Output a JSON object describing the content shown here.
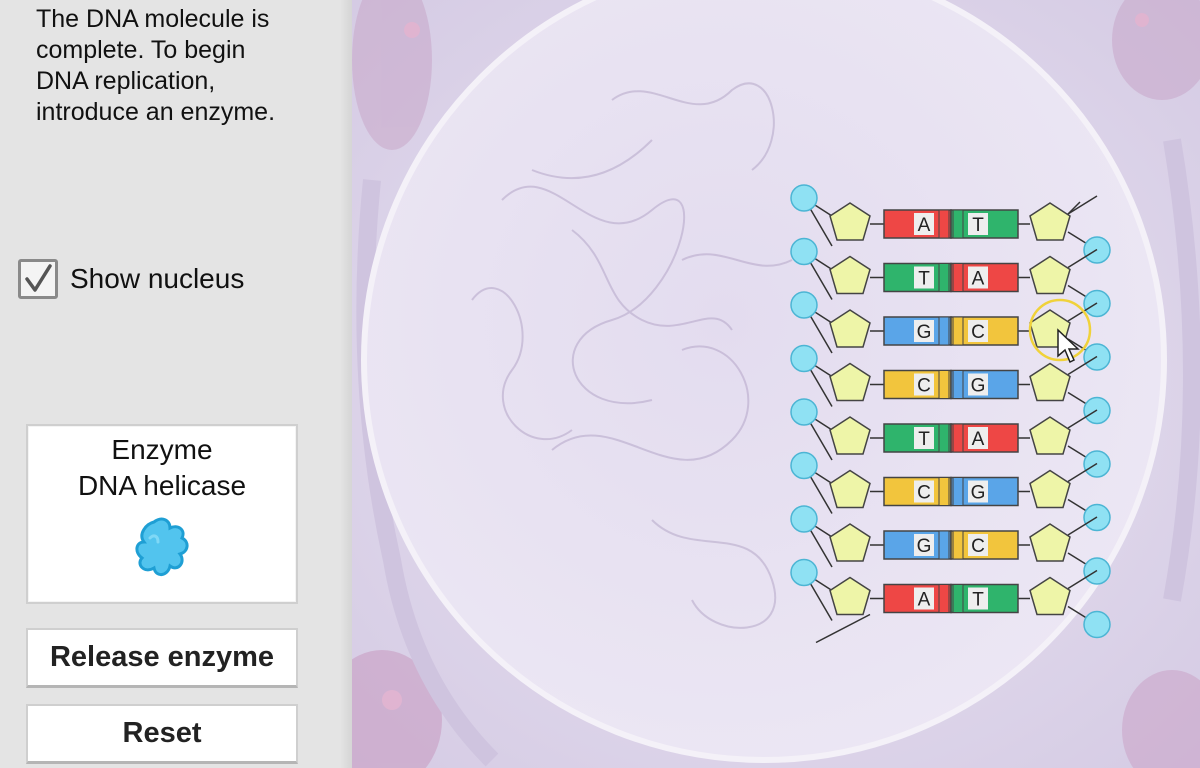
{
  "instructions": {
    "line1": "The DNA molecule is",
    "line2": "complete. To begin",
    "line3": "DNA replication,",
    "line4": "introduce an enzyme."
  },
  "show_nucleus": {
    "label": "Show nucleus",
    "checked": true
  },
  "enzyme_card": {
    "line1": "Enzyme",
    "line2": "DNA helicase",
    "icon": "helicase-blob-icon"
  },
  "buttons": {
    "release": "Release enzyme",
    "reset": "Reset"
  },
  "dna": {
    "pairs": [
      {
        "left": "A",
        "right": "T"
      },
      {
        "left": "T",
        "right": "A"
      },
      {
        "left": "G",
        "right": "C"
      },
      {
        "left": "C",
        "right": "G"
      },
      {
        "left": "T",
        "right": "A"
      },
      {
        "left": "C",
        "right": "G"
      },
      {
        "left": "G",
        "right": "C"
      },
      {
        "left": "A",
        "right": "T"
      }
    ]
  },
  "colors": {
    "A": "#ee4745",
    "T": "#2fb46c",
    "G": "#5aa5e8",
    "C": "#f2c53d",
    "sugar": "#eef5a8",
    "phosphate": "#8fe1f3",
    "nucleus": "#ede8f5",
    "cell": "#dcd4ea",
    "highlight": "#f0d23a"
  }
}
